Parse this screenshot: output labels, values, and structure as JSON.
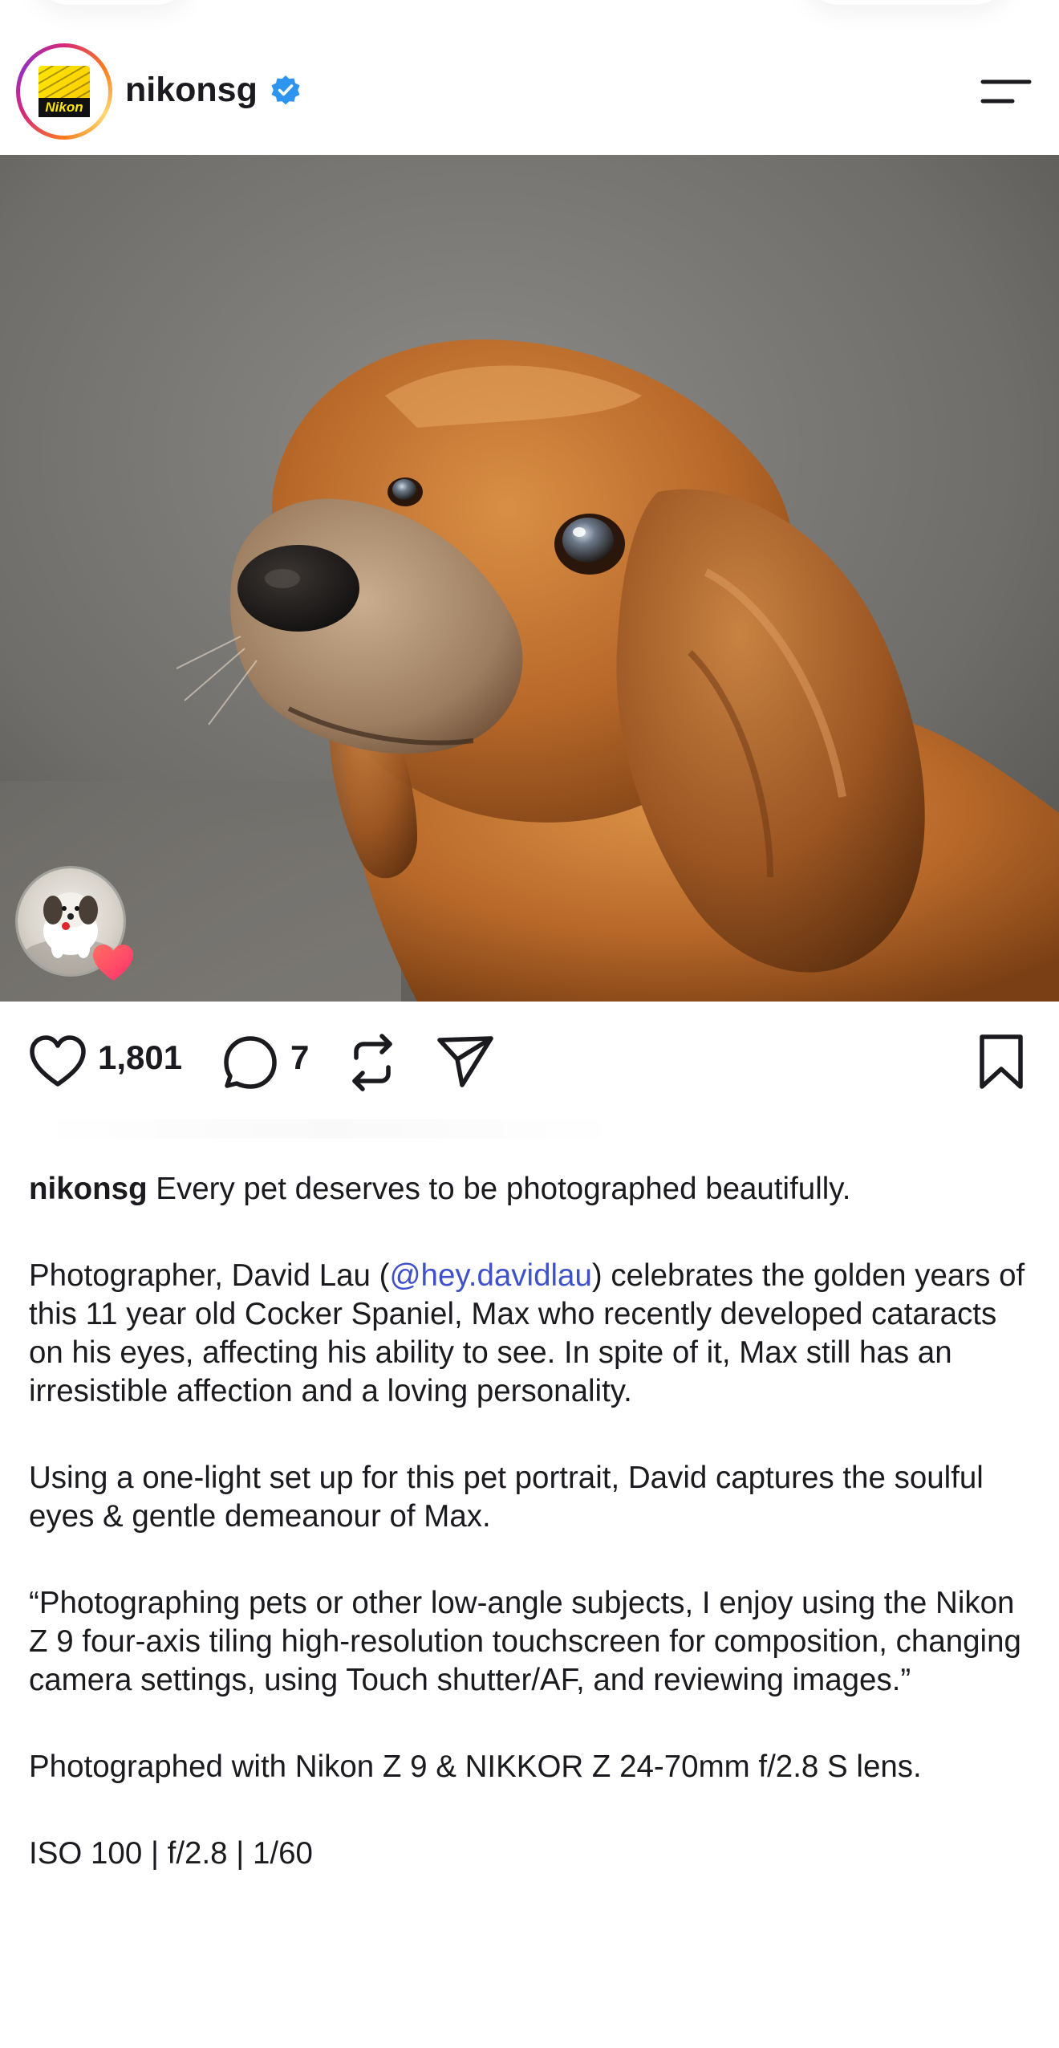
{
  "header": {
    "username": "nikonsg",
    "logo_text": "Nikon",
    "verified": true
  },
  "post": {
    "likes": "1,801",
    "comments": "7"
  },
  "caption": {
    "author": "nikonsg",
    "line1": " Every pet deserves to be photographed beautifully.",
    "p2_before": "Photographer, David Lau (",
    "p2_mention": "@hey.davidlau",
    "p2_after": ") celebrates the golden years of this 11 year old Cocker Spaniel, Max who recently developed cataracts on his eyes, affecting his ability to see. In spite of it, Max still has an irresistible affection and a loving personality.",
    "p3": "Using a one-light set up for this pet portrait, David captures the soulful eyes & gentle demeanour of Max.",
    "p4": "“Photographing pets or other low-angle subjects, I enjoy using the Nikon Z 9 four-axis tiling high-resolution touchscreen for composition, changing camera settings, using Touch shutter/AF, and reviewing images.”",
    "p5": "Photographed with Nikon Z 9 & NIKKOR Z 24-70mm f/2.8 S lens.",
    "p6": "ISO 100 | f/2.8 | 1/60"
  },
  "colors": {
    "text": "#1b1b1f",
    "mention": "#3f51c9",
    "verified": "#2d95f0",
    "heart_badge": "#ff4f6d"
  }
}
